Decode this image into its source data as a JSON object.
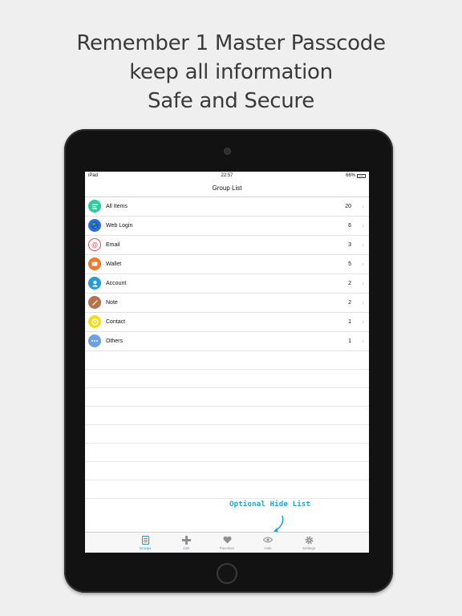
{
  "headline": {
    "line1": "Remember 1 Master Passcode",
    "line2": "keep all information",
    "line3": "Safe and Secure"
  },
  "statusbar": {
    "device": "iPad",
    "time": "22:57",
    "battery": "66%"
  },
  "navbar": {
    "title": "Group List"
  },
  "groups": [
    {
      "label": "All Items",
      "count": "20",
      "icon": "list-icon",
      "color": "#2ecc9a"
    },
    {
      "label": "Web Login",
      "count": "6",
      "icon": "globe-icon",
      "color": "#2e6fd6"
    },
    {
      "label": "Email",
      "count": "3",
      "icon": "at-icon",
      "color": "#e8494f"
    },
    {
      "label": "Wallet",
      "count": "5",
      "icon": "wallet-icon",
      "color": "#f0792b"
    },
    {
      "label": "Account",
      "count": "2",
      "icon": "person-icon",
      "color": "#2b9bd8"
    },
    {
      "label": "Note",
      "count": "2",
      "icon": "note-icon",
      "color": "#b5734d"
    },
    {
      "label": "Contact",
      "count": "1",
      "icon": "contact-icon",
      "color": "#f2dd1c"
    },
    {
      "label": "Others",
      "count": "1",
      "icon": "ellipsis-icon",
      "color": "#6ea0e8"
    }
  ],
  "hint": {
    "text": "Optional Hide List"
  },
  "tabs": [
    {
      "label": "Groups",
      "icon": "groups-icon",
      "active": true
    },
    {
      "label": "Add",
      "icon": "plus-icon",
      "active": false
    },
    {
      "label": "Favorites",
      "icon": "heart-icon",
      "active": false
    },
    {
      "label": "Hide",
      "icon": "eye-icon",
      "active": false
    },
    {
      "label": "Settings",
      "icon": "gear-icon",
      "active": false
    }
  ],
  "colors": {
    "accent": "#2a8fd8",
    "hint": "#1aa6e0",
    "background": "#efefef"
  }
}
